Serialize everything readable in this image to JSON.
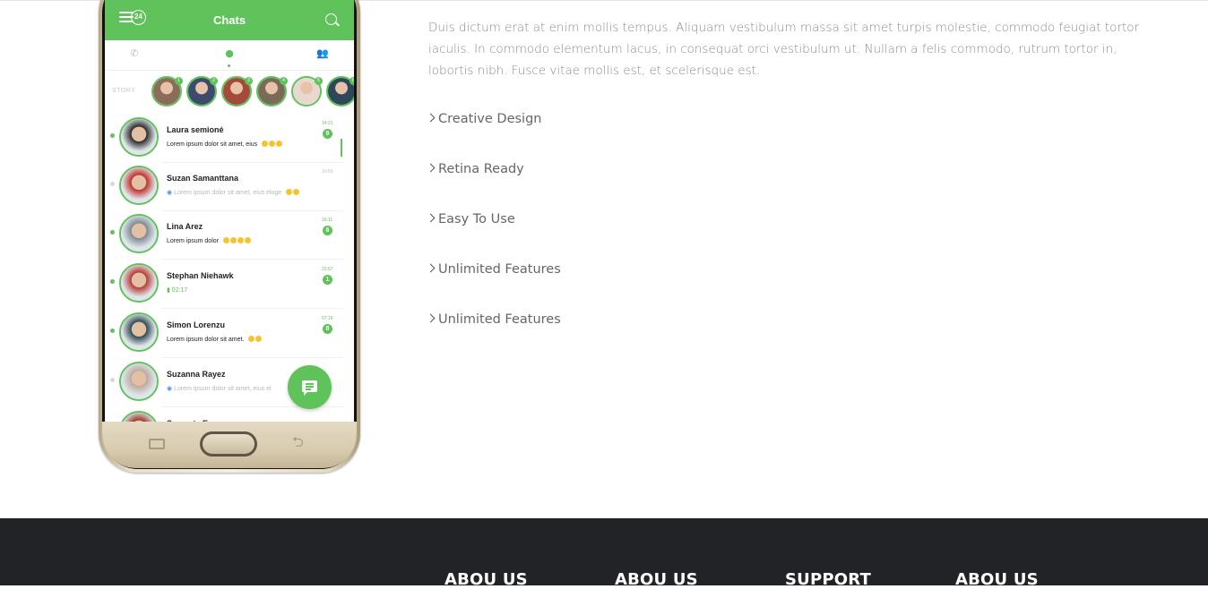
{
  "phone_app": {
    "title": "Chats",
    "menu_badge": "24",
    "story_label": "STORY",
    "story_badges": [
      "1",
      "2",
      "3",
      "4",
      "5",
      "6"
    ],
    "chats": [
      {
        "name": "Laura semioné",
        "message": "Lorem ipsum dolor sit amet, eius",
        "time": "14:21",
        "count": "9",
        "read": false,
        "online": true,
        "voice": false,
        "emojis": 3
      },
      {
        "name": "Suzan Samanttana",
        "message": "Lorem ipsum dolor sit amet, eius eloge",
        "time": "10:56",
        "count": "",
        "read": true,
        "online": false,
        "voice": false,
        "emojis": 2
      },
      {
        "name": "Lina Arez",
        "message": "Lorem ipsum dolor",
        "time": "16:11",
        "count": "6",
        "read": false,
        "online": true,
        "voice": false,
        "emojis": 4
      },
      {
        "name": "Stephan Niehawk",
        "message": "02:17",
        "time": "22:57",
        "count": "1",
        "read": false,
        "online": true,
        "voice": true,
        "emojis": 0
      },
      {
        "name": "Simon Lorenzu",
        "message": "Lorem ipsum dolor sit amet.",
        "time": "07:16",
        "count": "8",
        "read": false,
        "online": true,
        "voice": false,
        "emojis": 2
      },
      {
        "name": "Suzanna Rayez",
        "message": "Lorem ipsum dolor sit amet, eius el",
        "time": "",
        "count": "",
        "read": true,
        "online": false,
        "voice": false,
        "emojis": 0
      },
      {
        "name": "Samanta Esouc",
        "message": "",
        "time": "",
        "count": "",
        "read": false,
        "online": false,
        "voice": false,
        "emojis": 0
      }
    ]
  },
  "intro": "Duis dictum erat at enim mollis tempus. Aliquam vestibulum massa sit amet turpis molestie, commodo feugiat tortor iaculis. In commodo elementum lacus, in consequat orci vestibulum ut. Nullam a felis commodo, rutrum tortor in, lobortis nibh. Fusce vitae mollis est, et scelerisque est.",
  "features": [
    "Creative Design",
    "Retina Ready",
    "Easy To Use",
    "Unlimited Features",
    "Unlimited Features"
  ],
  "footer": {
    "headings": [
      "ABOU US",
      "ABOU US",
      "SUPPORT",
      "ABOU US"
    ]
  },
  "colors": {
    "accent_green": "#5fc25a",
    "footer_bg": "#212327",
    "body_text": "#8a8a8a"
  }
}
